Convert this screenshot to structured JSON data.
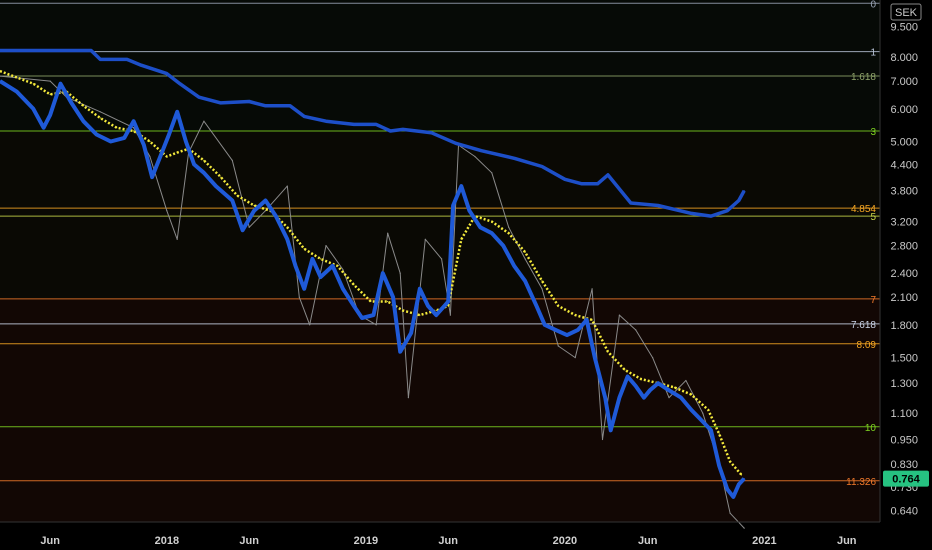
{
  "chart_data": {
    "type": "line",
    "currency": "SEK",
    "y_scale": "log",
    "ylim": [
      0.6,
      11.0
    ],
    "y_ticks": [
      "9.500",
      "8.000",
      "7.000",
      "6.000",
      "5.000",
      "4.400",
      "3.800",
      "3.200",
      "2.800",
      "2.400",
      "2.100",
      "1.800",
      "1.500",
      "1.300",
      "1.100",
      "0.950",
      "0.830",
      "0.730",
      "0.640"
    ],
    "y_tick_values": [
      9.5,
      8.0,
      7.0,
      6.0,
      5.0,
      4.4,
      3.8,
      3.2,
      2.8,
      2.4,
      2.1,
      1.8,
      1.5,
      1.3,
      1.1,
      0.95,
      0.83,
      0.73,
      0.64
    ],
    "x_ticks": [
      {
        "label": "Jun",
        "date": "2017-06-01"
      },
      {
        "label": "2018",
        "date": "2018-01-01"
      },
      {
        "label": "Jun",
        "date": "2018-06-01"
      },
      {
        "label": "2019",
        "date": "2019-01-01"
      },
      {
        "label": "Jun",
        "date": "2019-06-01"
      },
      {
        "label": "2020",
        "date": "2020-01-01"
      },
      {
        "label": "Jun",
        "date": "2020-06-01"
      },
      {
        "label": "2021",
        "date": "2021-01-01"
      },
      {
        "label": "Jun",
        "date": "2021-06-01"
      }
    ],
    "xlim": [
      "2017-03-01",
      "2021-08-01"
    ],
    "current_price": "0.764",
    "fib_levels": [
      {
        "label": "0",
        "value": 10.8,
        "color": "#9aa4b5"
      },
      {
        "label": "1",
        "value": 8.25,
        "color": "#b7c2d6"
      },
      {
        "label": "1.618",
        "value": 7.2,
        "color": "#8fa46a"
      },
      {
        "label": "3",
        "value": 5.3,
        "color": "#7ed321"
      },
      {
        "label": "4.854",
        "value": 3.45,
        "color": "#f5a623"
      },
      {
        "label": "5",
        "value": 3.3,
        "color": "#c7d64a"
      },
      {
        "label": "7",
        "value": 2.08,
        "color": "#f0792b"
      },
      {
        "label": "7.618",
        "value": 1.81,
        "color": "#c9d3e6"
      },
      {
        "label": "8.09",
        "value": 1.62,
        "color": "#f5a623"
      },
      {
        "label": "10",
        "value": 1.02,
        "color": "#7ed321"
      },
      {
        "label": "11.326",
        "value": 0.755,
        "color": "#f0792b"
      }
    ],
    "series": [
      {
        "type": "line",
        "points": [
          [
            "2017-03-01",
            7.0
          ],
          [
            "2017-04-01",
            6.6
          ],
          [
            "2017-05-01",
            6.0
          ],
          [
            "2017-05-20",
            5.4
          ],
          [
            "2017-06-01",
            5.8
          ],
          [
            "2017-06-20",
            6.9
          ],
          [
            "2017-07-10",
            6.2
          ],
          [
            "2017-08-01",
            5.6
          ],
          [
            "2017-08-25",
            5.2
          ],
          [
            "2017-09-20",
            5.0
          ],
          [
            "2017-10-15",
            5.1
          ],
          [
            "2017-11-01",
            5.6
          ],
          [
            "2017-11-20",
            4.9
          ],
          [
            "2017-12-05",
            4.1
          ],
          [
            "2017-12-20",
            4.6
          ],
          [
            "2018-01-05",
            5.2
          ],
          [
            "2018-01-20",
            5.9
          ],
          [
            "2018-02-05",
            5.0
          ],
          [
            "2018-02-20",
            4.4
          ],
          [
            "2018-03-10",
            4.2
          ],
          [
            "2018-04-01",
            3.9
          ],
          [
            "2018-05-01",
            3.6
          ],
          [
            "2018-05-20",
            3.05
          ],
          [
            "2018-06-10",
            3.4
          ],
          [
            "2018-07-01",
            3.6
          ],
          [
            "2018-07-20",
            3.3
          ],
          [
            "2018-08-10",
            2.9
          ],
          [
            "2018-08-25",
            2.5
          ],
          [
            "2018-09-10",
            2.2
          ],
          [
            "2018-09-25",
            2.6
          ],
          [
            "2018-10-10",
            2.35
          ],
          [
            "2018-11-01",
            2.5
          ],
          [
            "2018-11-20",
            2.2
          ],
          [
            "2018-12-10",
            2.0
          ],
          [
            "2018-12-25",
            1.87
          ],
          [
            "2019-01-15",
            1.9
          ],
          [
            "2019-02-01",
            2.4
          ],
          [
            "2019-02-20",
            2.1
          ],
          [
            "2019-03-05",
            1.55
          ],
          [
            "2019-03-25",
            1.72
          ],
          [
            "2019-04-10",
            2.2
          ],
          [
            "2019-04-25",
            2.0
          ],
          [
            "2019-05-10",
            1.9
          ],
          [
            "2019-05-25",
            2.0
          ],
          [
            "2019-06-01",
            2.05
          ],
          [
            "2019-06-10",
            3.5
          ],
          [
            "2019-06-25",
            3.9
          ],
          [
            "2019-07-10",
            3.4
          ],
          [
            "2019-07-30",
            3.1
          ],
          [
            "2019-08-20",
            3.0
          ],
          [
            "2019-09-10",
            2.8
          ],
          [
            "2019-09-30",
            2.5
          ],
          [
            "2019-10-20",
            2.3
          ],
          [
            "2019-11-10",
            2.0
          ],
          [
            "2019-11-25",
            1.8
          ],
          [
            "2019-12-15",
            1.75
          ],
          [
            "2020-01-05",
            1.7
          ],
          [
            "2020-01-25",
            1.75
          ],
          [
            "2020-02-10",
            1.85
          ],
          [
            "2020-02-25",
            1.5
          ],
          [
            "2020-03-15",
            1.2
          ],
          [
            "2020-03-25",
            1.0
          ],
          [
            "2020-04-10",
            1.2
          ],
          [
            "2020-04-25",
            1.35
          ],
          [
            "2020-05-10",
            1.28
          ],
          [
            "2020-05-25",
            1.2
          ],
          [
            "2020-06-05",
            1.25
          ],
          [
            "2020-06-20",
            1.3
          ],
          [
            "2020-07-10",
            1.25
          ],
          [
            "2020-08-01",
            1.2
          ],
          [
            "2020-08-20",
            1.12
          ],
          [
            "2020-09-10",
            1.05
          ],
          [
            "2020-09-25",
            1.0
          ],
          [
            "2020-10-10",
            0.82
          ],
          [
            "2020-10-25",
            0.72
          ],
          [
            "2020-11-05",
            0.69
          ],
          [
            "2020-11-15",
            0.74
          ],
          [
            "2020-11-25",
            0.764
          ]
        ]
      },
      {
        "type": "line",
        "points": [
          [
            "2017-03-01",
            7.4
          ],
          [
            "2017-05-01",
            6.9
          ],
          [
            "2017-06-01",
            6.5
          ],
          [
            "2017-07-01",
            6.6
          ],
          [
            "2017-08-01",
            6.1
          ],
          [
            "2017-09-01",
            5.7
          ],
          [
            "2017-10-01",
            5.4
          ],
          [
            "2017-11-01",
            5.3
          ],
          [
            "2017-12-01",
            5.0
          ],
          [
            "2018-01-01",
            4.6
          ],
          [
            "2018-01-20",
            4.7
          ],
          [
            "2018-02-10",
            4.8
          ],
          [
            "2018-03-10",
            4.5
          ],
          [
            "2018-04-10",
            4.1
          ],
          [
            "2018-05-10",
            3.7
          ],
          [
            "2018-06-10",
            3.5
          ],
          [
            "2018-07-10",
            3.4
          ],
          [
            "2018-08-10",
            3.1
          ],
          [
            "2018-09-10",
            2.75
          ],
          [
            "2018-10-10",
            2.6
          ],
          [
            "2018-11-10",
            2.5
          ],
          [
            "2018-12-10",
            2.25
          ],
          [
            "2019-01-10",
            2.05
          ],
          [
            "2019-02-10",
            2.05
          ],
          [
            "2019-03-10",
            1.95
          ],
          [
            "2019-04-10",
            1.9
          ],
          [
            "2019-05-10",
            1.95
          ],
          [
            "2019-06-01",
            2.0
          ],
          [
            "2019-06-25",
            2.9
          ],
          [
            "2019-07-20",
            3.3
          ],
          [
            "2019-08-20",
            3.2
          ],
          [
            "2019-09-20",
            3.0
          ],
          [
            "2019-10-20",
            2.7
          ],
          [
            "2019-11-20",
            2.3
          ],
          [
            "2019-12-20",
            2.0
          ],
          [
            "2020-01-20",
            1.9
          ],
          [
            "2020-02-20",
            1.85
          ],
          [
            "2020-03-20",
            1.55
          ],
          [
            "2020-04-20",
            1.4
          ],
          [
            "2020-05-20",
            1.33
          ],
          [
            "2020-06-20",
            1.3
          ],
          [
            "2020-07-20",
            1.27
          ],
          [
            "2020-08-20",
            1.22
          ],
          [
            "2020-09-20",
            1.12
          ],
          [
            "2020-10-10",
            0.98
          ],
          [
            "2020-10-30",
            0.84
          ],
          [
            "2020-11-20",
            0.78
          ]
        ]
      },
      {
        "type": "line",
        "points": [
          [
            "2017-03-01",
            8.3
          ],
          [
            "2017-08-15",
            8.3
          ],
          [
            "2017-09-01",
            7.9
          ],
          [
            "2017-10-20",
            7.9
          ],
          [
            "2017-11-15",
            7.65
          ],
          [
            "2018-01-01",
            7.3
          ],
          [
            "2018-01-25",
            6.9
          ],
          [
            "2018-03-01",
            6.4
          ],
          [
            "2018-04-10",
            6.2
          ],
          [
            "2018-06-01",
            6.25
          ],
          [
            "2018-07-01",
            6.1
          ],
          [
            "2018-08-15",
            6.1
          ],
          [
            "2018-09-10",
            5.75
          ],
          [
            "2018-10-20",
            5.6
          ],
          [
            "2018-12-10",
            5.5
          ],
          [
            "2019-01-20",
            5.5
          ],
          [
            "2019-02-15",
            5.3
          ],
          [
            "2019-03-10",
            5.35
          ],
          [
            "2019-05-01",
            5.25
          ],
          [
            "2019-06-15",
            4.95
          ],
          [
            "2019-08-01",
            4.75
          ],
          [
            "2019-10-01",
            4.55
          ],
          [
            "2019-11-20",
            4.35
          ],
          [
            "2020-01-01",
            4.05
          ],
          [
            "2020-02-01",
            3.95
          ],
          [
            "2020-03-01",
            3.95
          ],
          [
            "2020-03-20",
            4.15
          ],
          [
            "2020-05-01",
            3.55
          ],
          [
            "2020-06-20",
            3.5
          ],
          [
            "2020-08-20",
            3.35
          ],
          [
            "2020-09-25",
            3.3
          ],
          [
            "2020-10-25",
            3.4
          ],
          [
            "2020-11-15",
            3.6
          ],
          [
            "2020-11-25",
            3.8
          ]
        ]
      },
      {
        "type": "line",
        "points": [
          [
            "2017-03-01",
            7.2
          ],
          [
            "2017-06-01",
            7.0
          ],
          [
            "2017-07-01",
            6.4
          ],
          [
            "2017-09-01",
            5.9
          ],
          [
            "2017-11-01",
            5.4
          ],
          [
            "2017-12-01",
            4.6
          ],
          [
            "2018-01-01",
            3.4
          ],
          [
            "2018-01-20",
            2.9
          ],
          [
            "2018-02-10",
            4.7
          ],
          [
            "2018-03-10",
            5.6
          ],
          [
            "2018-05-01",
            4.5
          ],
          [
            "2018-06-01",
            3.1
          ],
          [
            "2018-07-01",
            3.4
          ],
          [
            "2018-08-10",
            3.9
          ],
          [
            "2018-09-01",
            2.1
          ],
          [
            "2018-09-20",
            1.8
          ],
          [
            "2018-10-20",
            2.8
          ],
          [
            "2018-11-20",
            2.45
          ],
          [
            "2018-12-20",
            1.9
          ],
          [
            "2019-01-20",
            1.8
          ],
          [
            "2019-02-10",
            3.0
          ],
          [
            "2019-03-05",
            2.4
          ],
          [
            "2019-03-20",
            1.2
          ],
          [
            "2019-04-20",
            2.9
          ],
          [
            "2019-05-20",
            2.6
          ],
          [
            "2019-06-05",
            1.9
          ],
          [
            "2019-06-20",
            4.9
          ],
          [
            "2019-07-20",
            4.6
          ],
          [
            "2019-08-20",
            4.2
          ],
          [
            "2019-09-20",
            3.1
          ],
          [
            "2019-10-20",
            2.6
          ],
          [
            "2019-11-20",
            2.2
          ],
          [
            "2019-12-20",
            1.6
          ],
          [
            "2020-01-20",
            1.5
          ],
          [
            "2020-02-20",
            2.2
          ],
          [
            "2020-03-10",
            0.95
          ],
          [
            "2020-04-10",
            1.9
          ],
          [
            "2020-05-10",
            1.75
          ],
          [
            "2020-06-10",
            1.5
          ],
          [
            "2020-07-10",
            1.2
          ],
          [
            "2020-08-10",
            1.32
          ],
          [
            "2020-09-10",
            1.1
          ],
          [
            "2020-10-10",
            0.83
          ],
          [
            "2020-10-30",
            0.63
          ],
          [
            "2020-11-25",
            0.58
          ]
        ]
      }
    ]
  }
}
